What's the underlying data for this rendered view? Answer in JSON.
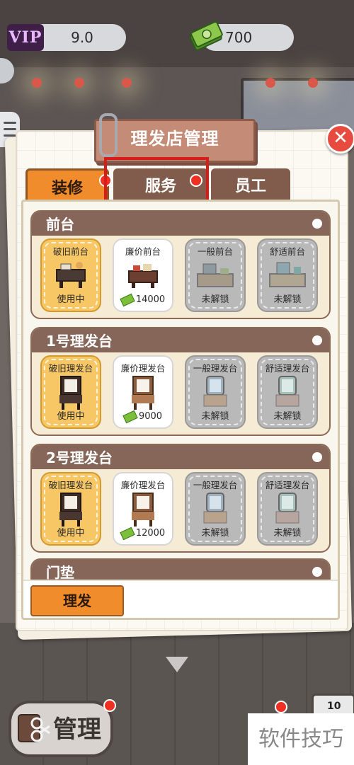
{
  "hud": {
    "vip_label": "VIP",
    "vip_value": "9.0",
    "cash_value": "700"
  },
  "modal": {
    "title": "理发店管理",
    "close_symbol": "✕",
    "tabs": [
      {
        "label": "装修"
      },
      {
        "label": "服务"
      },
      {
        "label": "员工"
      }
    ],
    "sections": [
      {
        "title": "前台",
        "items": [
          {
            "name": "破旧前台",
            "status": "使用中",
            "price": ""
          },
          {
            "name": "廉价前台",
            "status": "",
            "price": "14000"
          },
          {
            "name": "一般前台",
            "status": "未解锁",
            "price": ""
          },
          {
            "name": "舒适前台",
            "status": "未解锁",
            "price": ""
          }
        ]
      },
      {
        "title": "1号理发台",
        "items": [
          {
            "name": "破旧理发台",
            "status": "使用中",
            "price": ""
          },
          {
            "name": "廉价理发台",
            "status": "",
            "price": "9000"
          },
          {
            "name": "一般理发台",
            "status": "未解锁",
            "price": ""
          },
          {
            "name": "舒适理发台",
            "status": "未解锁",
            "price": ""
          }
        ]
      },
      {
        "title": "2号理发台",
        "items": [
          {
            "name": "破旧理发台",
            "status": "使用中",
            "price": ""
          },
          {
            "name": "廉价理发台",
            "status": "",
            "price": "12000"
          },
          {
            "name": "一般理发台",
            "status": "未解锁",
            "price": ""
          },
          {
            "name": "舒适理发台",
            "status": "未解锁",
            "price": ""
          }
        ]
      },
      {
        "title": "门垫"
      }
    ],
    "footer_button": "理发"
  },
  "bottom": {
    "manage_label": "管理",
    "task_count": "10"
  },
  "watermark": "软件技巧",
  "colors": {
    "accent": "#f18c2c",
    "highlight": "#d91c17",
    "section_header": "#87665a"
  }
}
